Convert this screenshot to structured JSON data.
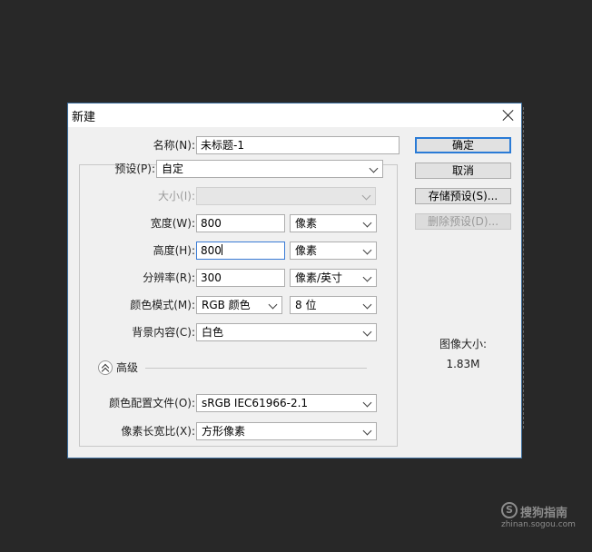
{
  "dialog": {
    "title": "新建"
  },
  "form": {
    "name": {
      "label": "名称(N):",
      "value": "未标题-1"
    },
    "preset": {
      "label": "预设(P):",
      "value": "自定"
    },
    "size": {
      "label": "大小(I):",
      "value": ""
    },
    "width": {
      "label": "宽度(W):",
      "value": "800",
      "unit": "像素"
    },
    "height": {
      "label": "高度(H):",
      "value": "800",
      "unit": "像素"
    },
    "resolution": {
      "label": "分辨率(R):",
      "value": "300",
      "unit": "像素/英寸"
    },
    "color_mode": {
      "label": "颜色模式(M):",
      "value": "RGB 颜色",
      "depth": "8 位"
    },
    "background": {
      "label": "背景内容(C):",
      "value": "白色"
    },
    "advanced": {
      "label": "高级"
    },
    "color_profile": {
      "label": "颜色配置文件(O):",
      "value": "sRGB IEC61966-2.1"
    },
    "pixel_aspect": {
      "label": "像素长宽比(X):",
      "value": "方形像素"
    }
  },
  "buttons": {
    "ok": "确定",
    "cancel": "取消",
    "save_preset": "存储预设(S)...",
    "delete_preset": "删除预设(D)..."
  },
  "image_size": {
    "label": "图像大小:",
    "value": "1.83M"
  },
  "watermark": {
    "brand": "搜狗指南",
    "logo_letter": "S",
    "url": "zhinan.sogou.com"
  },
  "icons": {
    "close": "close-icon",
    "dropdown": "chevron-down-icon",
    "advanced_toggle": "chevron-up-circle-icon"
  },
  "colors": {
    "background": "#282828",
    "dialog": "#f0f0f0",
    "accent": "#2a7bd6"
  }
}
